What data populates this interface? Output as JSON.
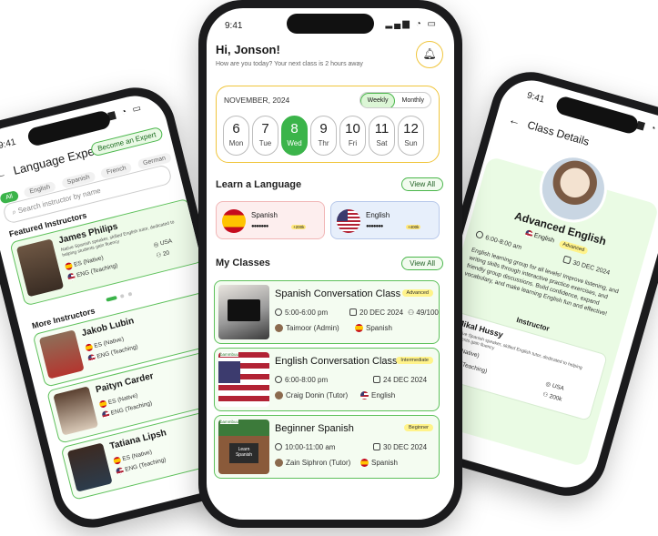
{
  "left": {
    "time": "9:41",
    "title": "Language Experts",
    "become_expert": "Become an Expert",
    "filters": [
      "All",
      "English",
      "Spanish",
      "French",
      "German",
      "Dutch"
    ],
    "search_placeholder": "Search instructor by name",
    "featured_heading": "Featured Instructors",
    "featured": {
      "name": "James Philips",
      "bio": "Native Spanish speaker, skilled English tutor, dedicated to helping students gain fluency",
      "native": "ES (Native)",
      "teaching": "ENG (Teaching)",
      "country": "USA",
      "students": "20"
    },
    "more_heading": "More Instructors",
    "more": [
      {
        "name": "Jakob Lubin",
        "native": "ES (Native)",
        "teaching": "ENG (Teaching)"
      },
      {
        "name": "Paityn Carder",
        "native": "ES (Native)",
        "teaching": "ENG (Teaching)"
      },
      {
        "name": "Tatiana Lipsh",
        "native": "ES (Native)",
        "teaching": "ENG (Teaching)"
      }
    ]
  },
  "main": {
    "time": "9:41",
    "greeting": "Hi, Jonson!",
    "subtitle": "How are you today? Your next class is 2 hours away",
    "calendar": {
      "month": "NOVEMBER, 2024",
      "weekly": "Weekly",
      "monthly": "Monthly",
      "days": [
        {
          "num": "6",
          "wd": "Mon"
        },
        {
          "num": "7",
          "wd": "Tue"
        },
        {
          "num": "8",
          "wd": "Wed"
        },
        {
          "num": "9",
          "wd": "Thr"
        },
        {
          "num": "10",
          "wd": "Fri"
        },
        {
          "num": "11",
          "wd": "Sat"
        },
        {
          "num": "12",
          "wd": "Sun"
        }
      ],
      "selected_index": 2
    },
    "learn_heading": "Learn a Language",
    "view_all": "View All",
    "languages": [
      {
        "name": "Spanish",
        "count": "+200k"
      },
      {
        "name": "English",
        "count": "+400k"
      }
    ],
    "classes_heading": "My Classes",
    "classes": [
      {
        "title": "Spanish Conversation Class",
        "level": "Advanced",
        "time": "5:00-6:00 pm",
        "date": "20 DEC 2024",
        "participants": "49/100",
        "host": "Taimoor (Admin)",
        "language": "Spanish"
      },
      {
        "title": "English Conversation Class",
        "level": "Intermediate",
        "time": "6:00-8:00 pm",
        "date": "24 DEC 2024",
        "participants": "",
        "host": "Craig Donin (Tutor)",
        "language": "English"
      },
      {
        "title": "Beginner Spanish",
        "level": "Beginner",
        "time": "10:00-11:00 am",
        "date": "30 DEC 2024",
        "participants": "",
        "host": "Zain Siphron (Tutor)",
        "language": "Spanish"
      }
    ],
    "thumb_brand": "bammbuu",
    "thumb_caption": "Learn Spanish"
  },
  "right": {
    "time": "9:41",
    "title": "Class Details",
    "class_title": "Advanced English",
    "language": "English",
    "level": "Advanced",
    "time_range": "6:00-8:00 am",
    "date": "30 DEC 2024",
    "description": "English learning group for all levels! Improve listening, and writing skills through interactive practice exercises, and friendly group discussions. Build confidence, expand vocabulary, and make learning English fun and effective!",
    "instructor_heading": "Instructor",
    "instructor": {
      "name": "Mikal Hussy",
      "bio": "Native Spanish speaker, skilled English tutor, dedicated to helping students gain fluency",
      "native": "ES (Native)",
      "teaching": "ENG (Teaching)",
      "country": "USA",
      "students": "200k"
    }
  },
  "colors": {
    "accent": "#3bb44a",
    "accent_light": "#eaf9e6",
    "badge": "#fff38a",
    "frame": "#1b1b1d"
  }
}
